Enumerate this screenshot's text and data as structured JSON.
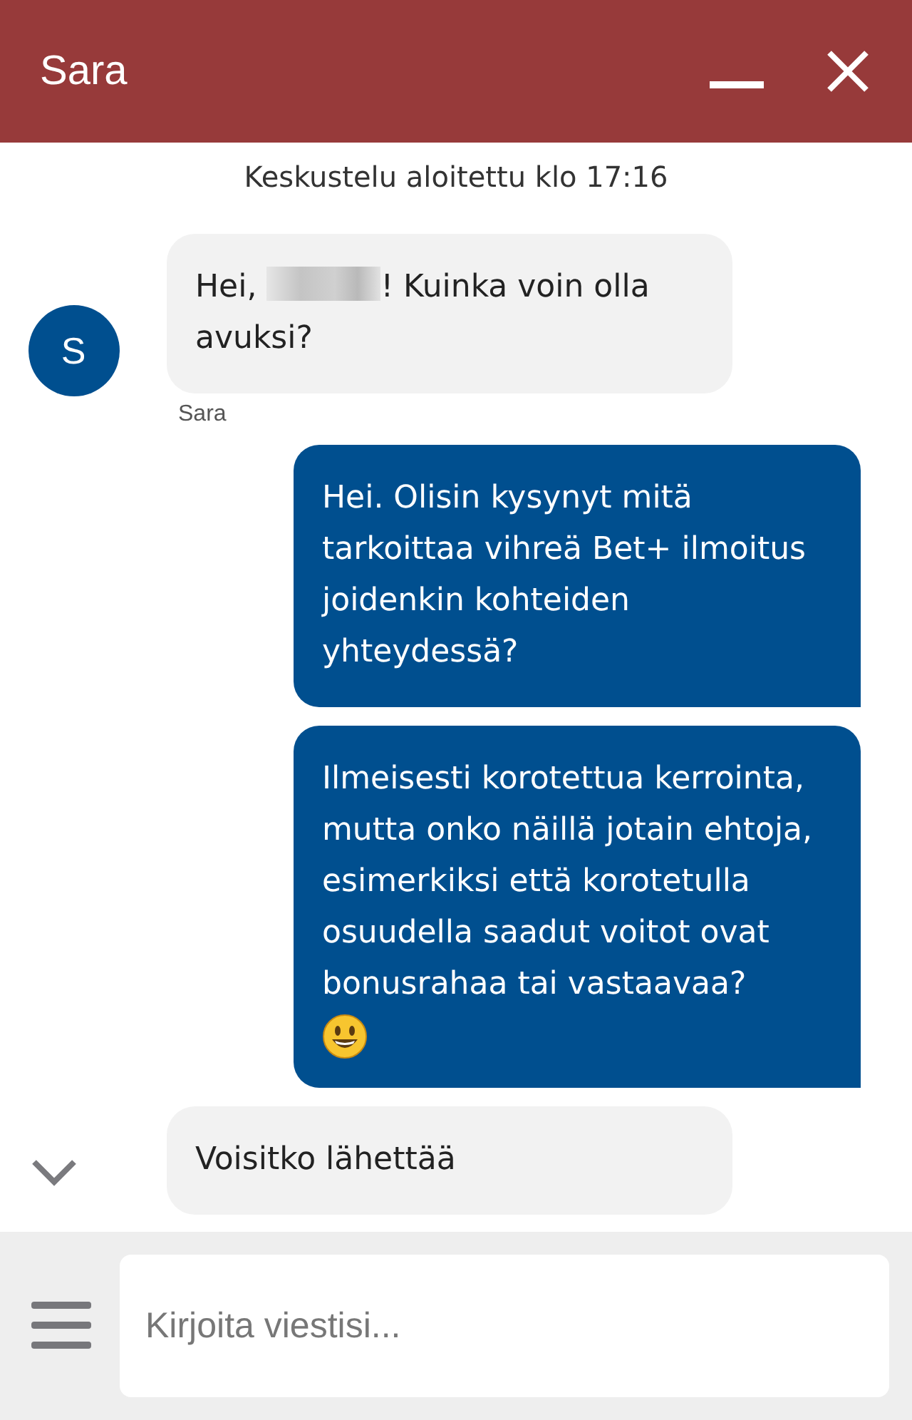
{
  "header": {
    "title": "Sara"
  },
  "conversation": {
    "started": "Keskustelu aloitettu klo 17:16"
  },
  "messages": [
    {
      "kind": "agent",
      "avatar": "S",
      "before": "Hei, ",
      "redacted": true,
      "after": "! Kuinka voin olla avuksi?",
      "sender": "Sara"
    },
    {
      "kind": "user",
      "text": "Hei. Olisin kysynyt mitä tarkoittaa vihreä Bet+ ilmoitus joidenkin kohteiden yhteydessä?",
      "emoji": false
    },
    {
      "kind": "user",
      "text": "Ilmeisesti korotettua kerrointa, mutta onko näillä jotain ehtoja, esimerkiksi että korotetulla osuudella saadut voitot ovat bonusrahaa tai vastaavaa?",
      "emoji": true
    },
    {
      "kind": "agent",
      "before": "Voisitko lähettää",
      "redacted": false
    }
  ],
  "composer": {
    "placeholder": "Kirjoita viestisi..."
  }
}
